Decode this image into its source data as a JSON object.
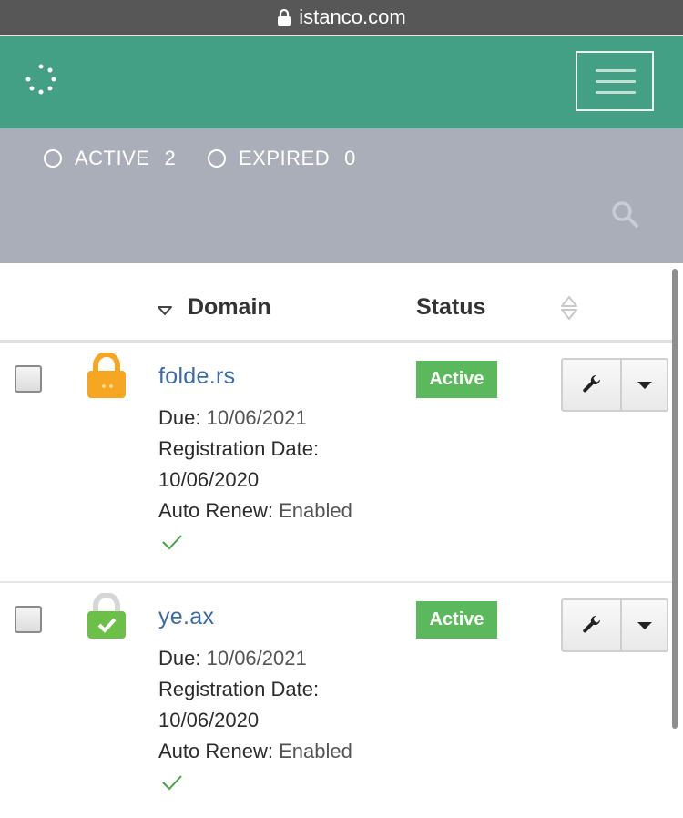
{
  "browser": {
    "url": "istanco.com"
  },
  "header": {
    "logo_icon": "spinner-dots-icon",
    "menu_icon": "hamburger-icon"
  },
  "filters": [
    {
      "label": "ACTIVE",
      "count": "2"
    },
    {
      "label": "EXPIRED",
      "count": "0"
    }
  ],
  "table": {
    "columns": {
      "domain": "Domain",
      "status": "Status"
    },
    "rows": [
      {
        "domain": "folde.rs",
        "due_label": "Due:",
        "due": "10/06/2021",
        "reg_label": "Registration Date:",
        "reg_date": "10/06/2020",
        "renew_label": "Auto Renew:",
        "renew": "Enabled",
        "status": "Active",
        "lock_color": "#f5a623"
      },
      {
        "domain": "ye.ax",
        "due_label": "Due:",
        "due": "10/06/2021",
        "reg_label": "Registration Date:",
        "reg_date": "10/06/2020",
        "renew_label": "Auto Renew:",
        "renew": "Enabled",
        "status": "Active",
        "lock_color": "#6cbf47"
      }
    ]
  },
  "colors": {
    "brand": "#44a085",
    "filterbar": "#a9aeb8",
    "active": "#5cb85c",
    "link": "#3b6aa8"
  }
}
